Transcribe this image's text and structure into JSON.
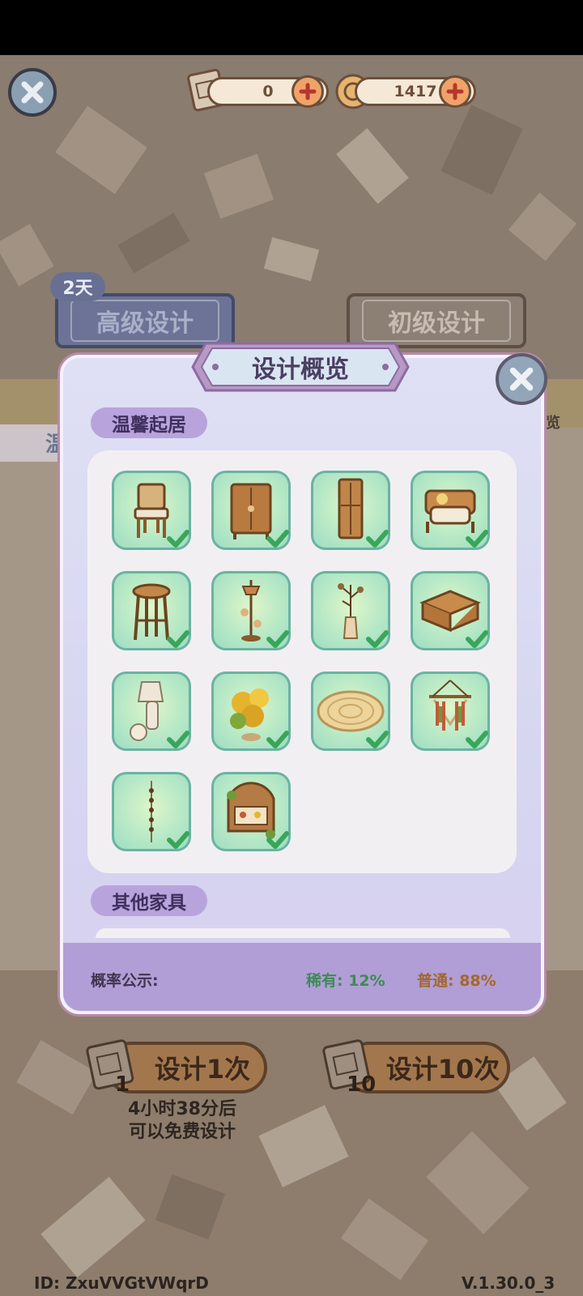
{
  "currencies": [
    {
      "name": "design-scroll",
      "value": "0"
    },
    {
      "name": "coin",
      "value": "1417"
    }
  ],
  "tabs": {
    "advanced_label": "高级设计",
    "basic_label": "初级设计",
    "advanced_badge": "2天"
  },
  "behind": {
    "left_text": "温",
    "right_text": "概览"
  },
  "modal": {
    "title": "设计概览",
    "sections": {
      "cozy": "温馨起居",
      "other": "其他家具"
    },
    "items": [
      {
        "icon": "wicker-chair",
        "owned": true
      },
      {
        "icon": "wooden-cabinet",
        "owned": true
      },
      {
        "icon": "tall-bookcase",
        "owned": true
      },
      {
        "icon": "cushioned-sofa",
        "owned": true
      },
      {
        "icon": "bar-stool",
        "owned": true
      },
      {
        "icon": "hanging-lamp",
        "owned": true
      },
      {
        "icon": "vase-branch",
        "owned": true
      },
      {
        "icon": "wooden-table",
        "owned": true
      },
      {
        "icon": "table-lamp",
        "owned": true
      },
      {
        "icon": "yellow-flowers",
        "owned": true
      },
      {
        "icon": "round-rug",
        "owned": true
      },
      {
        "icon": "macrame-hanging",
        "owned": true
      },
      {
        "icon": "bead-string",
        "owned": true
      },
      {
        "icon": "flower-shelf",
        "owned": true
      }
    ],
    "odds": {
      "label": "概率公示:",
      "rare": "稀有: 12%",
      "common": "普通: 88%"
    }
  },
  "actions": {
    "design_once": "设计1次",
    "design_once_count": "1",
    "design_ten": "设计10次",
    "design_ten_count": "10",
    "free_timer_line1": "4小时38分后",
    "free_timer_line2": "可以免费设计"
  },
  "footer": {
    "id": "ID: ZxuVVGtVWqrD",
    "version": "V.1.30.0_3"
  },
  "colors": {
    "modal_bg": "#dcdcf3",
    "tag": "#b9a3dc",
    "tile": "#b8e9c6",
    "check": "#3aa65a",
    "button": "#a3774d",
    "rare": "#3f8a55",
    "common": "#a4672c"
  }
}
